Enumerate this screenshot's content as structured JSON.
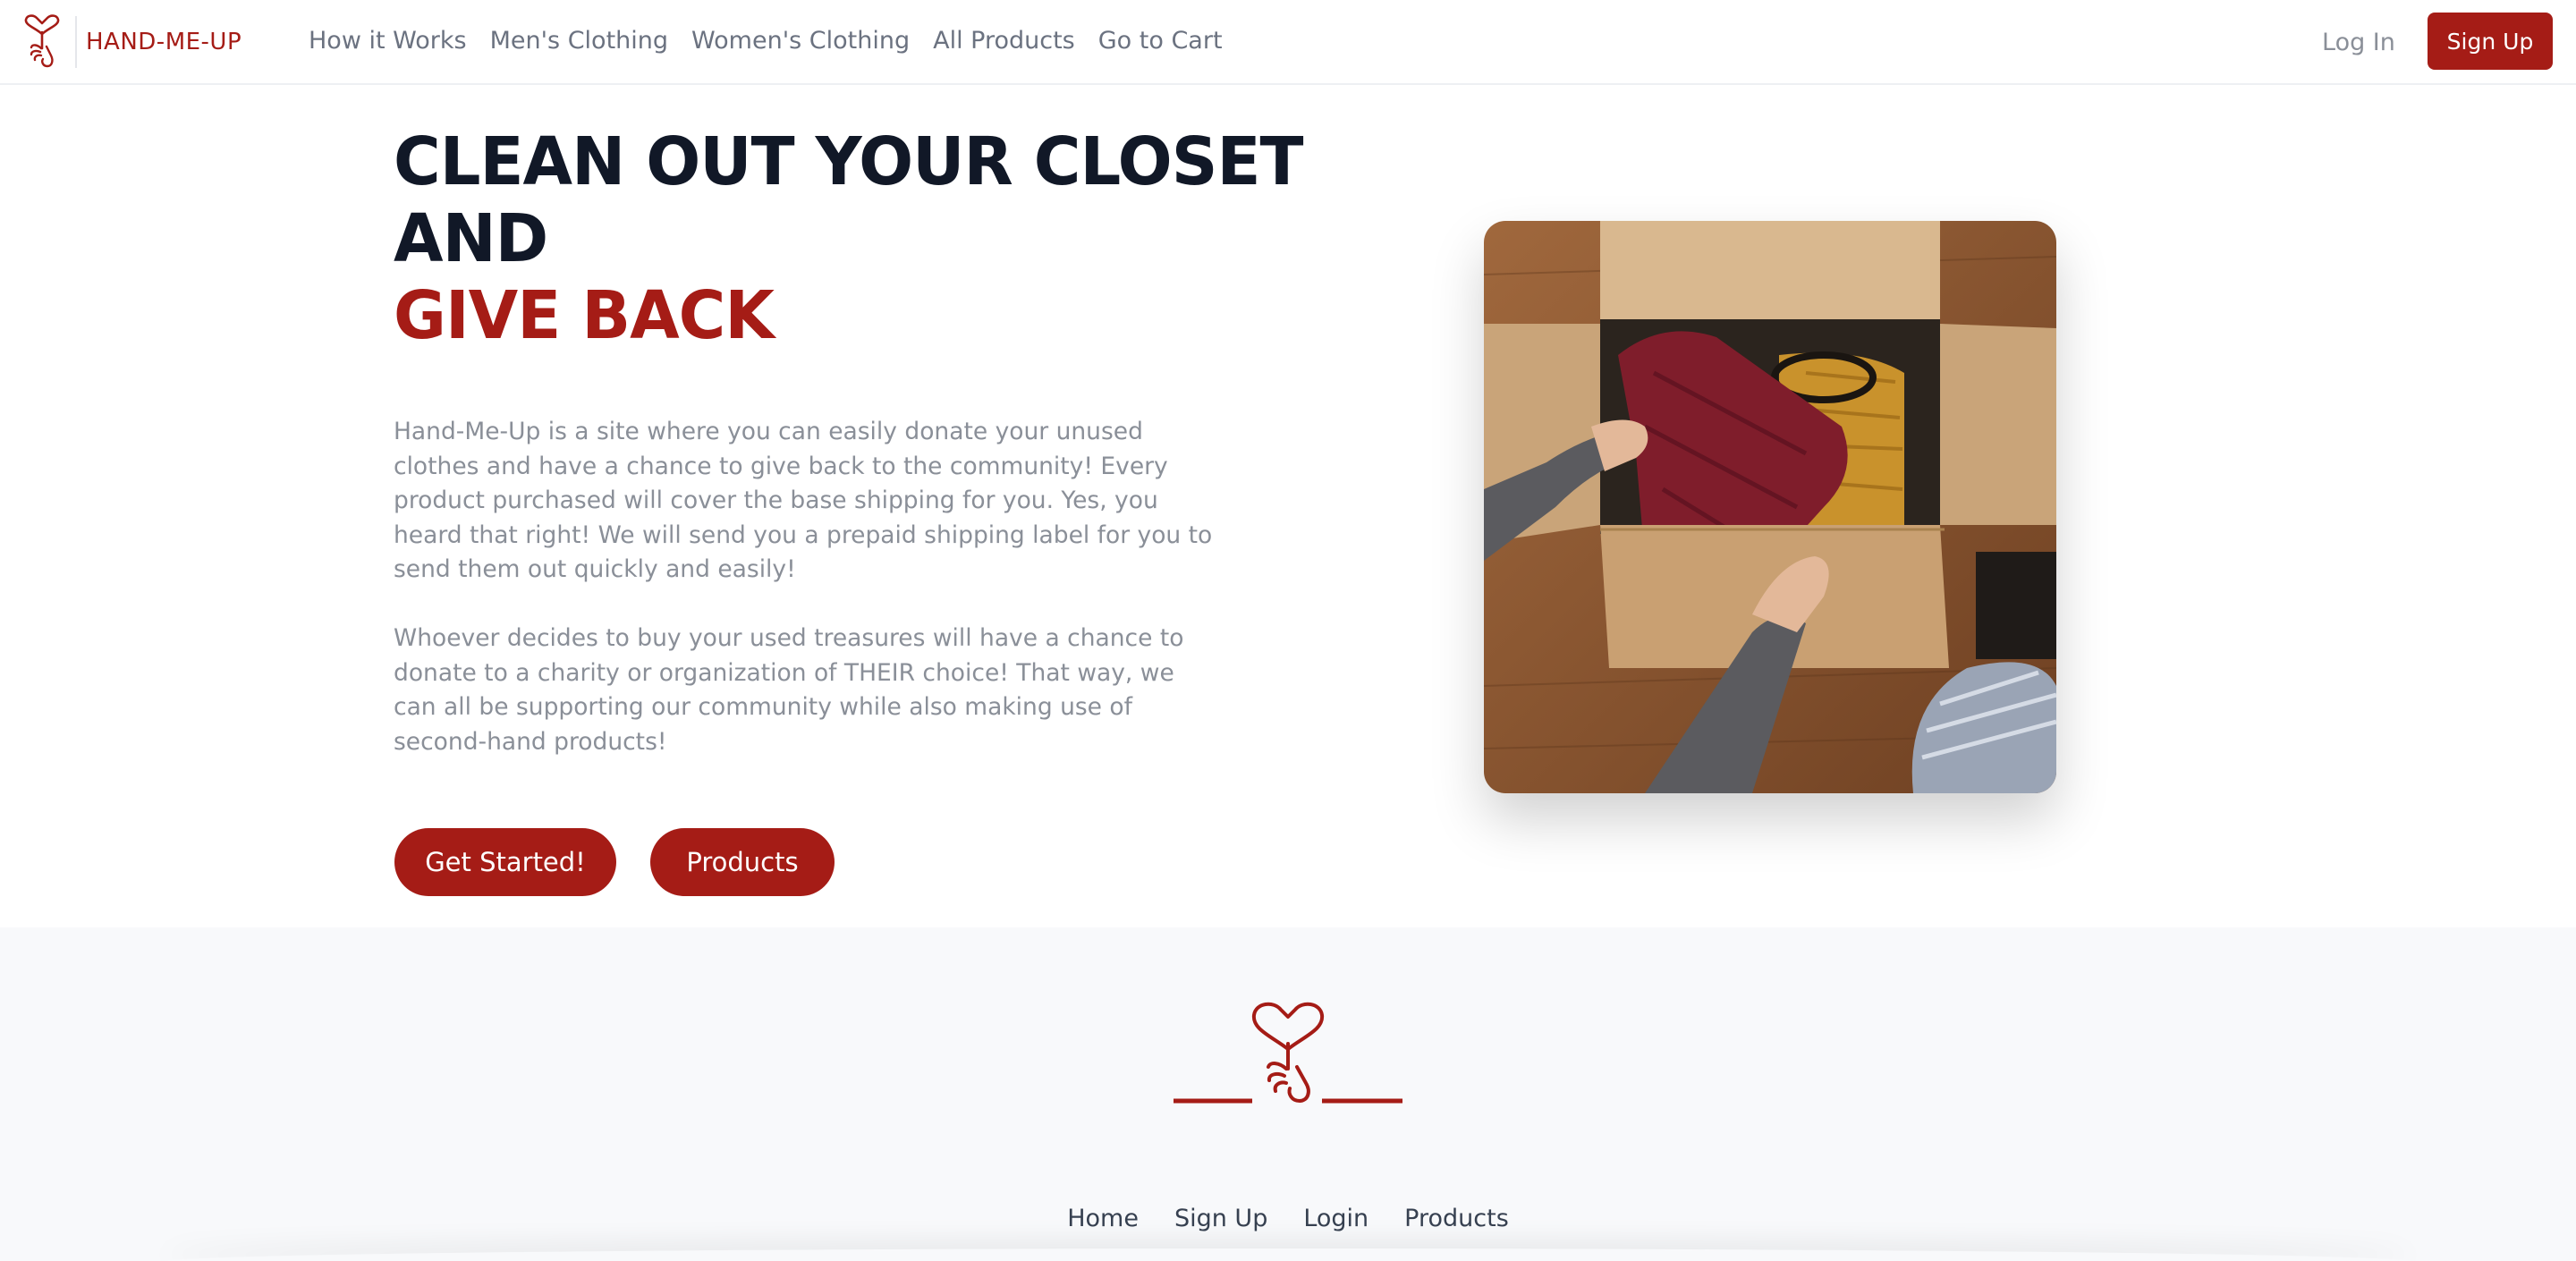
{
  "brand": {
    "name": "HAND-ME-UP",
    "logo_icon": "heart-hand-icon"
  },
  "nav": {
    "links": [
      "How it Works",
      "Men's Clothing",
      "Women's Clothing",
      "All Products",
      "Go to Cart"
    ],
    "login_label": "Log In",
    "signup_label": "Sign Up"
  },
  "hero": {
    "title_line_1": "CLEAN OUT YOUR CLOSET",
    "title_line_2": "AND",
    "title_accent": "GIVE BACK",
    "paragraph_1": "Hand-Me-Up is a site where you can easily donate your unused clothes and have a chance to give back to the community! Every product purchased will cover the base shipping for you. Yes, you heard that right! We will send you a prepaid shipping label for you to send them out quickly and easily!",
    "paragraph_2": "Whoever decides to buy your used treasures will have a chance to donate to a charity or organization of THEIR choice! That way, we can all be supporting our community while also making use of second-hand products!",
    "cta_primary": "Get Started!",
    "cta_secondary": "Products"
  },
  "footer": {
    "logo_icon": "heart-hand-icon",
    "links": [
      "Home",
      "Sign Up",
      "Login",
      "Products"
    ]
  },
  "colors": {
    "accent": "#a51c16",
    "heading": "#111827",
    "body_text": "#8a8f98",
    "footer_bg": "#f8f9fb"
  }
}
